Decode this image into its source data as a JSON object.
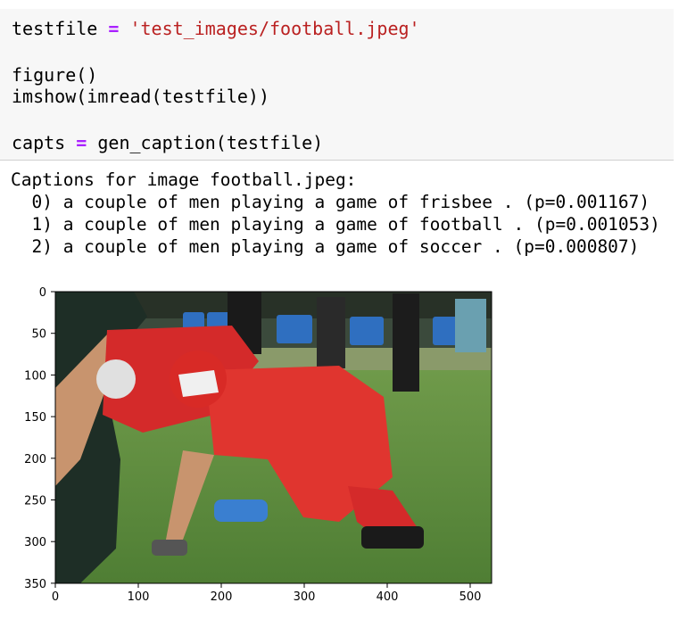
{
  "code": {
    "line1": {
      "var": "testfile",
      "op": "=",
      "str": "'test_images/football.jpeg'"
    },
    "line2": "figure()",
    "line3": "imshow(imread(testfile))",
    "line4": {
      "var": "capts",
      "op": "=",
      "call": "gen_caption(testfile)"
    }
  },
  "output": {
    "header": "Captions for image football.jpeg:",
    "captions": [
      "  0) a couple of men playing a game of frisbee . (p=0.001167)",
      "  1) a couple of men playing a game of football . (p=0.001053)",
      "  2) a couple of men playing a game of soccer . (p=0.000807)"
    ]
  },
  "plot": {
    "x_ticks": [
      "0",
      "100",
      "200",
      "300",
      "400",
      "500"
    ],
    "y_ticks": [
      "0",
      "50",
      "100",
      "150",
      "200",
      "250",
      "300",
      "350"
    ],
    "image_description_icon": "football-photo"
  }
}
